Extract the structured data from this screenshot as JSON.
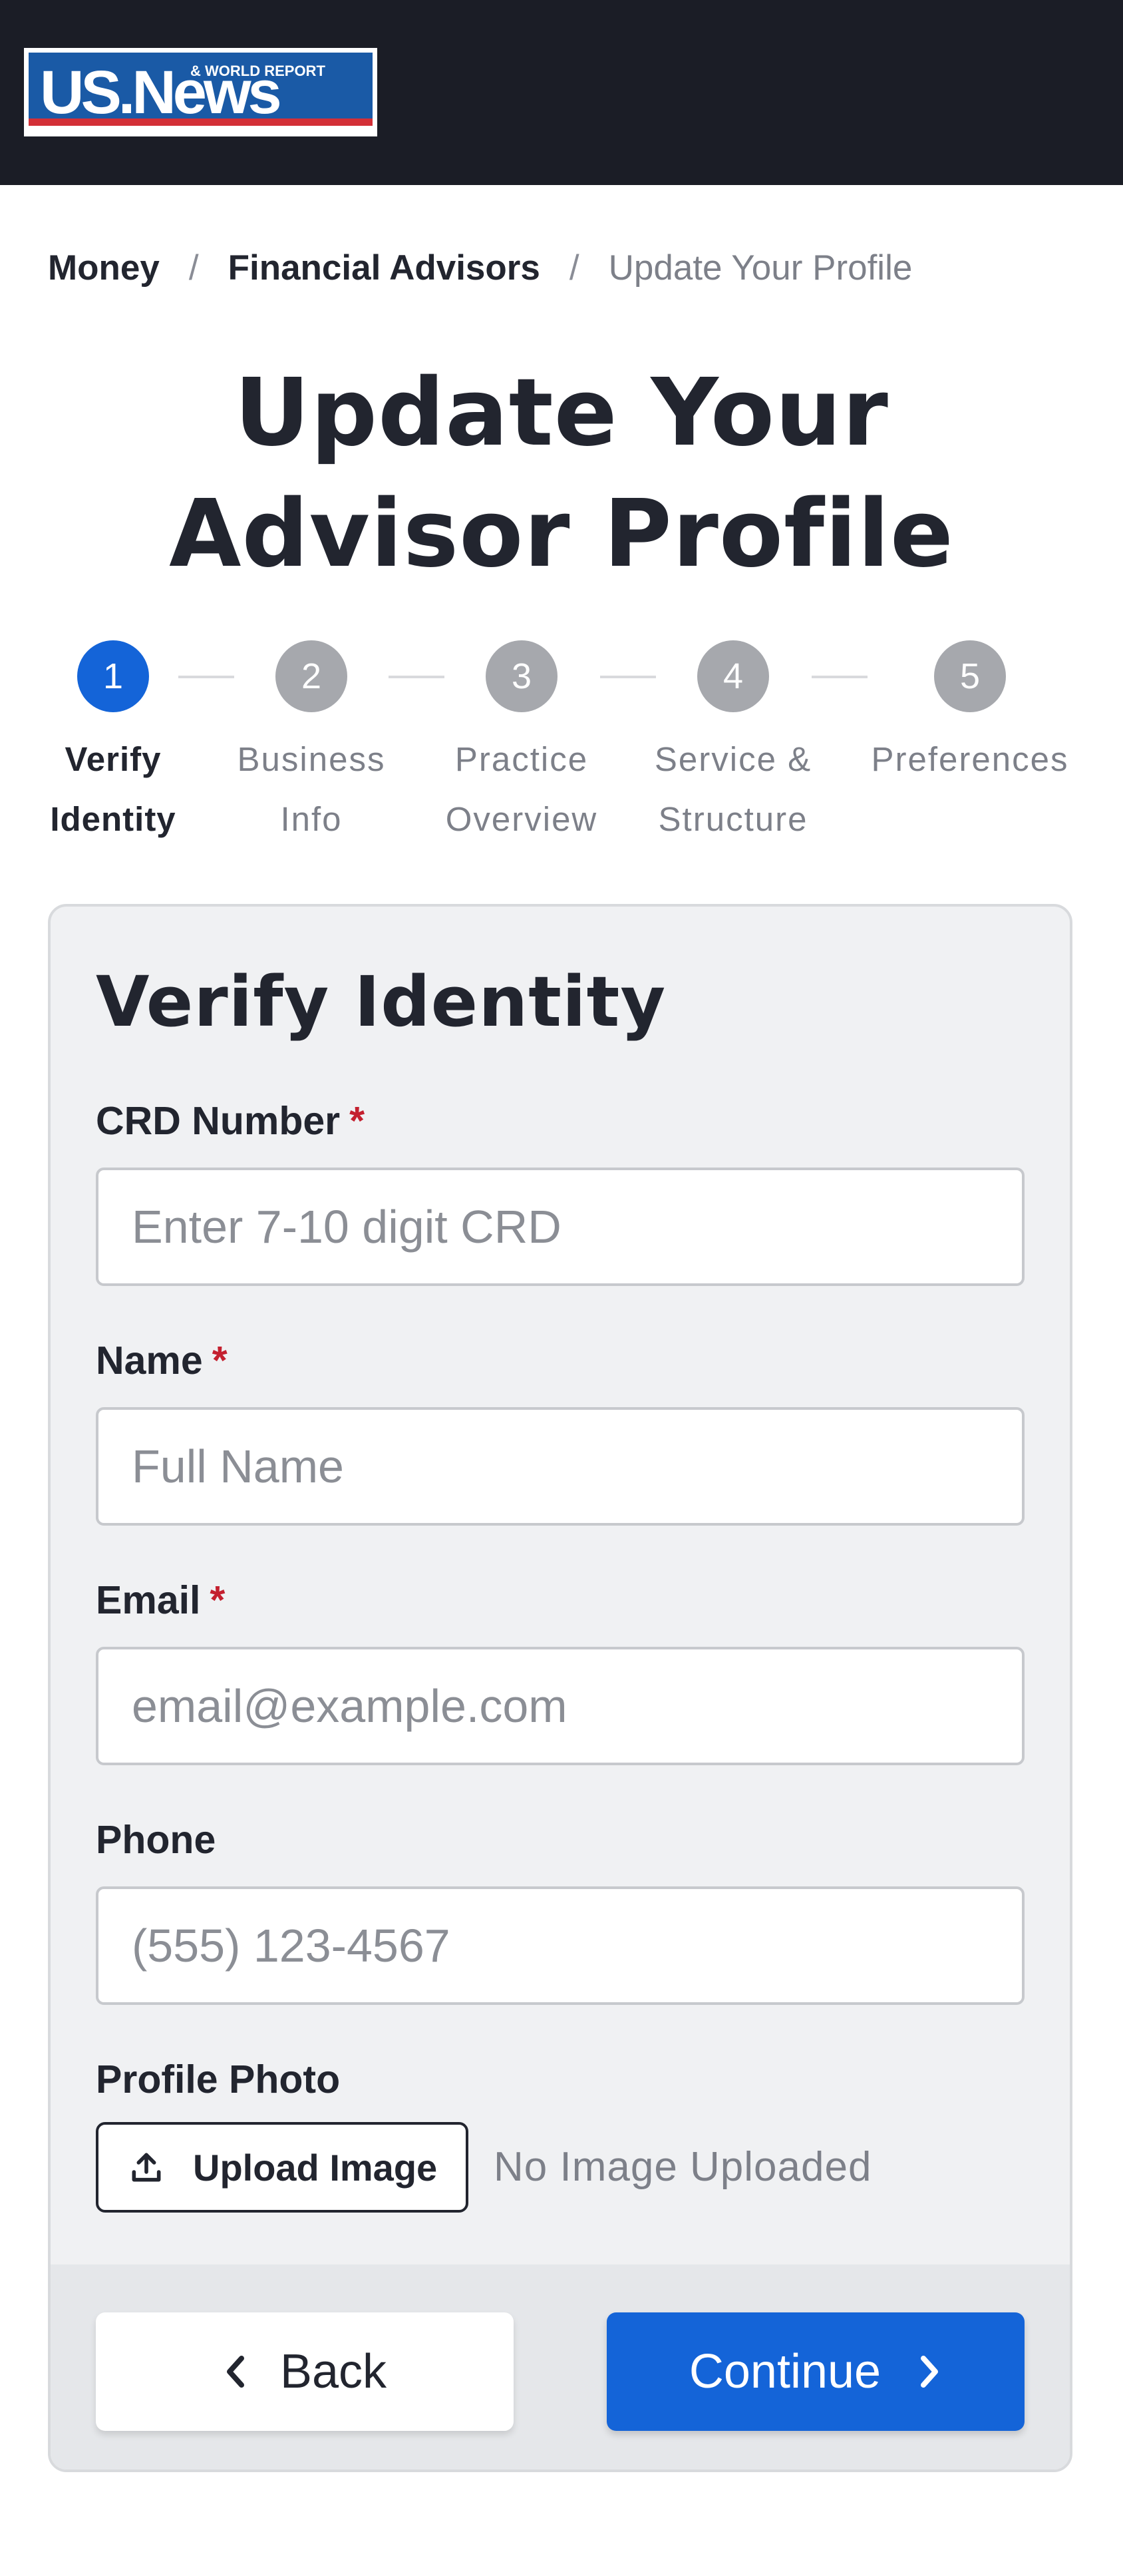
{
  "header": {
    "logo": {
      "main": "US.News",
      "tag": "& WORLD REPORT"
    }
  },
  "breadcrumb": {
    "items": [
      "Money",
      "Financial Advisors",
      "Update Your Profile"
    ],
    "separator": "/"
  },
  "page_title": "Update Your Advisor Profile",
  "stepper": {
    "steps": [
      {
        "number": "1",
        "line1": "Verify",
        "line2": "Identity",
        "active": true
      },
      {
        "number": "2",
        "line1": "Business",
        "line2": "Info",
        "active": false
      },
      {
        "number": "3",
        "line1": "Practice",
        "line2": "Overview",
        "active": false
      },
      {
        "number": "4",
        "line1": "Service &",
        "line2": "Structure",
        "active": false
      },
      {
        "number": "5",
        "line1": "Preferences",
        "line2": "",
        "active": false
      }
    ]
  },
  "form": {
    "title": "Verify Identity",
    "required_marker": "*",
    "crd": {
      "label": "CRD Number",
      "placeholder": "Enter 7-10 digit CRD",
      "value": ""
    },
    "name": {
      "label": "Name",
      "placeholder": "Full Name",
      "value": ""
    },
    "email": {
      "label": "Email",
      "placeholder": "email@example.com",
      "value": ""
    },
    "phone": {
      "label": "Phone",
      "placeholder": "(555) 123-4567",
      "value": ""
    },
    "photo": {
      "label": "Profile Photo",
      "upload_label": "Upload Image",
      "status": "No Image Uploaded"
    }
  },
  "footer": {
    "back_label": "Back",
    "continue_label": "Continue"
  },
  "colors": {
    "header_bg": "#1b1d26",
    "accent": "#1464d8",
    "required": "#c4202f",
    "step_inactive": "#a6a8ad",
    "logo_blue": "#1a5aa6",
    "logo_red": "#d32f37"
  },
  "icons": [
    "upload-icon",
    "chevron-left-icon",
    "chevron-right-icon"
  ]
}
